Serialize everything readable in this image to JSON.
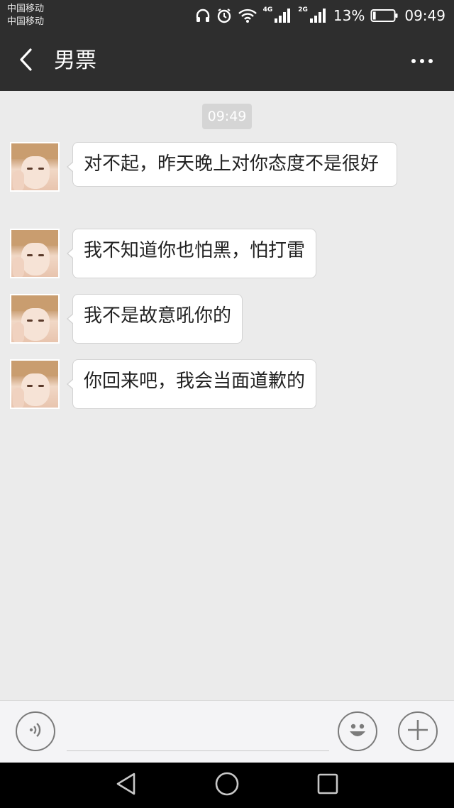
{
  "status_bar": {
    "carrier_1": "中国移动",
    "carrier_2": "中国移动",
    "network_1": "4G",
    "network_2": "2G",
    "battery_percent": "13%",
    "battery_level": 0.13,
    "time": "09:49",
    "icons": [
      "headphones-icon",
      "alarm-icon",
      "wifi-icon",
      "signal-icon",
      "battery-icon"
    ]
  },
  "nav": {
    "title": "男票",
    "back_icon": "chevron-left-icon",
    "more_icon": "more-dots-icon"
  },
  "chat": {
    "timestamp": "09:49",
    "messages": [
      {
        "sender": "friend",
        "text": "对不起，昨天晚上对你态度不是很好"
      },
      {
        "sender": "friend",
        "text": "我不知道你也怕黑，怕打雷"
      },
      {
        "sender": "friend",
        "text": "我不是故意吼你的"
      },
      {
        "sender": "friend",
        "text": "你回来吧，我会当面道歉的"
      }
    ]
  },
  "input_bar": {
    "voice_icon": "voice-icon",
    "emoji_icon": "emoji-icon",
    "plus_icon": "plus-icon",
    "input_value": ""
  },
  "system_nav": {
    "icons": [
      "back-triangle-icon",
      "home-circle-icon",
      "recent-square-icon"
    ]
  },
  "colors": {
    "header_bg": "#2e2e2e",
    "chat_bg": "#ebebeb",
    "bubble_bg": "#ffffff",
    "timestamp_bg": "#d5d5d5"
  }
}
